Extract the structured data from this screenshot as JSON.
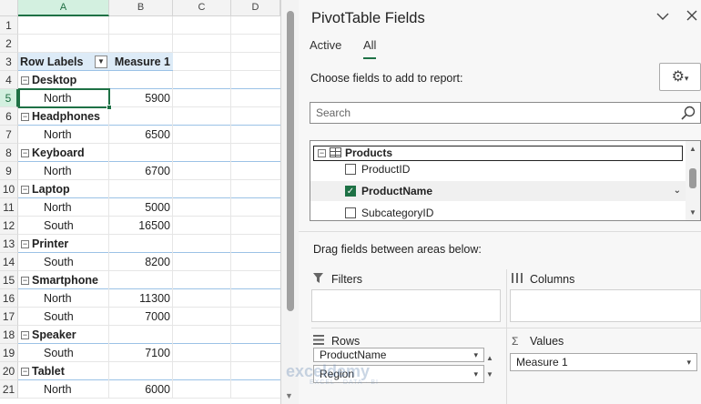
{
  "sheet": {
    "columns": [
      "A",
      "B",
      "C",
      "D"
    ],
    "selected_column": "A",
    "selected_row": "5",
    "rows": [
      {
        "n": "1",
        "type": "empty",
        "a": "",
        "b": ""
      },
      {
        "n": "2",
        "type": "empty",
        "a": "",
        "b": ""
      },
      {
        "n": "3",
        "type": "header",
        "a": "Row Labels",
        "b": "Measure 1"
      },
      {
        "n": "4",
        "type": "group",
        "a": "Desktop",
        "b": ""
      },
      {
        "n": "5",
        "type": "sub",
        "a": "North",
        "b": "5900"
      },
      {
        "n": "6",
        "type": "group",
        "a": "Headphones",
        "b": ""
      },
      {
        "n": "7",
        "type": "sub",
        "a": "North",
        "b": "6500"
      },
      {
        "n": "8",
        "type": "group",
        "a": "Keyboard",
        "b": ""
      },
      {
        "n": "9",
        "type": "sub",
        "a": "North",
        "b": "6700"
      },
      {
        "n": "10",
        "type": "group",
        "a": "Laptop",
        "b": ""
      },
      {
        "n": "11",
        "type": "sub",
        "a": "North",
        "b": "5000"
      },
      {
        "n": "12",
        "type": "sub",
        "a": "South",
        "b": "16500"
      },
      {
        "n": "13",
        "type": "group",
        "a": "Printer",
        "b": ""
      },
      {
        "n": "14",
        "type": "sub",
        "a": "South",
        "b": "8200"
      },
      {
        "n": "15",
        "type": "group",
        "a": "Smartphone",
        "b": ""
      },
      {
        "n": "16",
        "type": "sub",
        "a": "North",
        "b": "11300"
      },
      {
        "n": "17",
        "type": "sub",
        "a": "South",
        "b": "7000"
      },
      {
        "n": "18",
        "type": "group",
        "a": "Speaker",
        "b": ""
      },
      {
        "n": "19",
        "type": "sub",
        "a": "South",
        "b": "7100"
      },
      {
        "n": "20",
        "type": "group",
        "a": "Tablet",
        "b": ""
      },
      {
        "n": "21",
        "type": "sub",
        "a": "North",
        "b": "6000"
      }
    ]
  },
  "panel": {
    "title": "PivotTable Fields",
    "tabs": [
      {
        "label": "Active"
      },
      {
        "label": "All"
      }
    ],
    "active_tab": "All",
    "choose_label": "Choose fields to add to report:",
    "search_placeholder": "Search",
    "table_name": "Products",
    "fields": [
      {
        "label": "ProductID",
        "checked": false,
        "highlight": false
      },
      {
        "label": "ProductName",
        "checked": true,
        "highlight": true
      },
      {
        "label": "SubcategoryID",
        "checked": false,
        "highlight": false
      }
    ],
    "drag_label": "Drag fields between areas below:",
    "areas": {
      "filters": "Filters",
      "columns": "Columns",
      "rows": "Rows",
      "values": "Values"
    },
    "rows_items": [
      "ProductName",
      "Region"
    ],
    "values_items": [
      "Measure 1"
    ]
  },
  "watermark": {
    "text": "exceldemy",
    "sub": "EXCEL · DATA · BI"
  },
  "colors": {
    "accent": "#1e7145",
    "header_fill": "#ddebf7",
    "group_line": "#9bc2e6"
  }
}
